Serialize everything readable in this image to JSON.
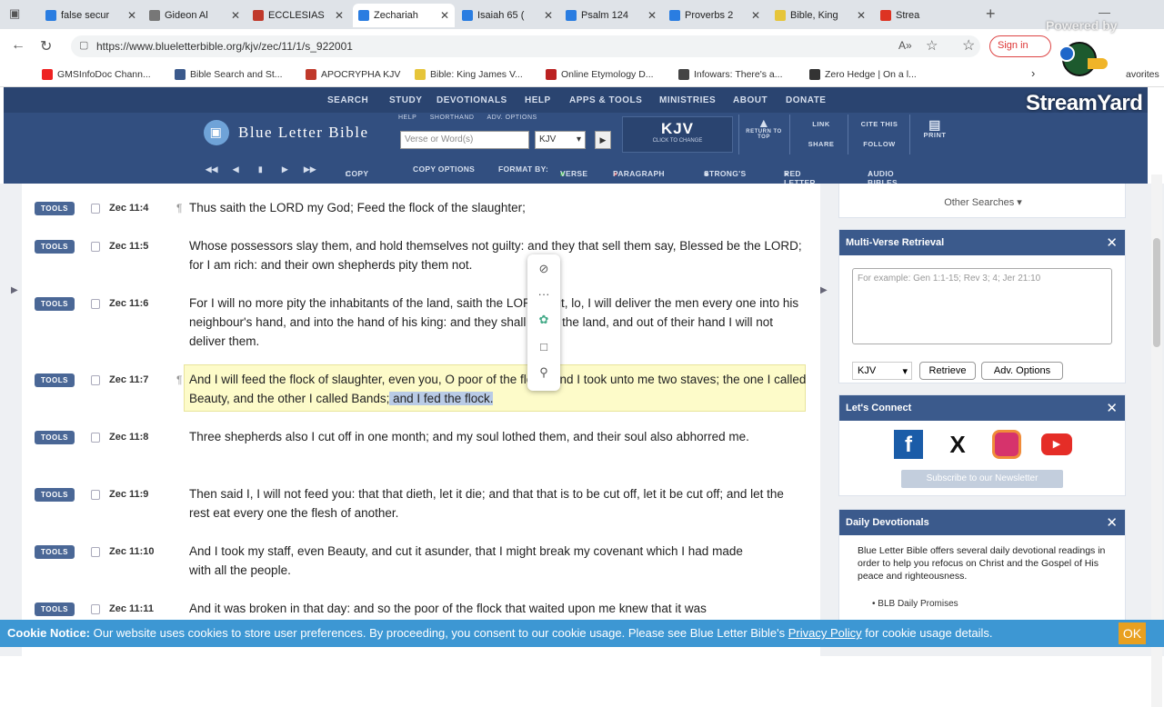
{
  "browser": {
    "tabs": [
      {
        "label": "false secur",
        "color": "#2a7de1"
      },
      {
        "label": "Gideon Al",
        "color": "#777"
      },
      {
        "label": "ECCLESIAS",
        "color": "#c0392b"
      },
      {
        "label": "Zechariah",
        "color": "#2a7de1"
      },
      {
        "label": "Isaiah 65 (",
        "color": "#2a7de1"
      },
      {
        "label": "Psalm 124",
        "color": "#2a7de1"
      },
      {
        "label": "Proverbs 2",
        "color": "#2a7de1"
      },
      {
        "label": "Bible, King",
        "color": "#e6c53a"
      },
      {
        "label": "Strea",
        "color": "#d32"
      }
    ],
    "url": "https://www.blueletterbible.org/kjv/zec/11/1/s_922001",
    "read_aloud": "A»",
    "signin": "Sign in",
    "bookmarks": [
      {
        "label": "GMSInfoDoc Chann...",
        "color": "#e22"
      },
      {
        "label": "Bible Search and St...",
        "color": "#3b5a8c"
      },
      {
        "label": "APOCRYPHA KJV",
        "color": "#c0392b"
      },
      {
        "label": "Bible: King James V...",
        "color": "#e6c53a"
      },
      {
        "label": "Online Etymology D...",
        "color": "#b22"
      },
      {
        "label": "Infowars: There's a...",
        "color": "#444"
      },
      {
        "label": "Zero Hedge | On a l...",
        "color": "#333"
      }
    ],
    "favorites": "avorites"
  },
  "overlay": {
    "powered_by": "Powered by",
    "brand": "StreamYard"
  },
  "site": {
    "topnav": [
      "SEARCH",
      "STUDY",
      "DEVOTIONALS",
      "HELP",
      "APPS & TOOLS",
      "MINISTRIES",
      "ABOUT",
      "DONATE"
    ],
    "logo": "Blue Letter Bible",
    "search_opts": [
      "HELP",
      "SHORTHAND",
      "ADV. OPTIONS"
    ],
    "search_placeholder": "Verse or Word(s)",
    "search_version": "KJV",
    "version_big": "KJV",
    "version_small": "CLICK TO CHANGE",
    "return_top": "RETURN TO TOP",
    "link": "LINK",
    "share": "SHARE",
    "cite": "CITE THIS",
    "follow": "FOLLOW",
    "print": "PRINT",
    "toolbar": {
      "copy": "COPY",
      "copy_options": "COPY OPTIONS",
      "format_by": "FORMAT BY:",
      "verse": "VERSE",
      "paragraph": "PARAGRAPH",
      "strongs": "STRONG'S",
      "red_letter": "RED LETTER",
      "audio": "AUDIO BIBLES"
    }
  },
  "tools_label": "TOOLS",
  "verses": [
    {
      "ref": "Zec 11:4",
      "pilcrow": true,
      "text": "Thus saith the LORD my God; Feed the flock of the slaughter;"
    },
    {
      "ref": "Zec 11:5",
      "pilcrow": false,
      "text": "Whose possessors slay them, and hold themselves not guilty: and they that sell them say, Blessed be the LORD; for I am rich: and their own shepherds pity them not."
    },
    {
      "ref": "Zec 11:6",
      "pilcrow": false,
      "text": "For I will no more pity the inhabitants of the land, saith the LORD: but, lo, I will deliver the men every one into his neighbour's hand, and into the hand of his king: and they shall smite the land, and out of their hand I will not deliver them."
    },
    {
      "ref": "Zec 11:7",
      "pilcrow": true,
      "text_a": "And I will feed the flock of slaughter, even you, O poor of the flock. And I took unto me two staves; the one I called Beauty, and the other I called Bands;",
      "text_sel": " and I fed the flock."
    },
    {
      "ref": "Zec 11:8",
      "pilcrow": false,
      "text": "Three shepherds also I cut off in one month; and my soul lothed them, and their soul also abhorred me."
    },
    {
      "ref": "Zec 11:9",
      "pilcrow": false,
      "text": "Then said I, I will not feed you: that that dieth, let it die; and that that is to be cut off, let it be cut off; and let the rest eat every one the flesh of another."
    },
    {
      "ref": "Zec 11:10",
      "pilcrow": false,
      "text": "And I took my staff, even Beauty, and cut it asunder, that I might break my covenant which I had made with all the people."
    },
    {
      "ref": "Zec 11:11",
      "pilcrow": false,
      "text": "And it was broken in that day: and so the poor of the flock that waited upon me knew that it was"
    }
  ],
  "sidebar": {
    "other_searches": "Other Searches ▾",
    "multi_verse": {
      "title": "Multi-Verse Retrieval",
      "placeholder": "For example: Gen 1:1-15; Rev 3; 4; Jer 21:10",
      "version": "KJV",
      "retrieve": "Retrieve",
      "adv": "Adv. Options"
    },
    "connect": {
      "title": "Let's Connect",
      "newsletter": "Subscribe to our Newsletter"
    },
    "devotionals": {
      "title": "Daily Devotionals",
      "body": "Blue Letter Bible offers several daily devotional readings in order to help you refocus on Christ and the Gospel of His peace and righteousness.",
      "item1": "BLB Daily Promises"
    }
  },
  "cookie": {
    "label": "Cookie Notice:",
    "text": " Our website uses cookies to store user preferences. By proceeding, you consent to our cookie usage. Please see Blue Letter Bible's ",
    "link": "Privacy Policy",
    "text2": " for cookie usage details.",
    "ok": "OK"
  }
}
